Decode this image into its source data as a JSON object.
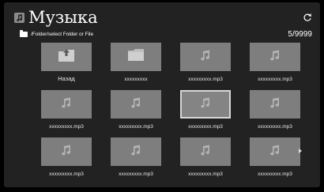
{
  "header": {
    "title": "Музыка",
    "path": "/Folder/select Folder or File",
    "counter": "5/9999"
  },
  "items": [
    {
      "label": "Назад",
      "type": "back",
      "icon": "folder-up-icon"
    },
    {
      "label": "xxxxxxxxx",
      "type": "folder",
      "icon": "folder-icon"
    },
    {
      "label": "xxxxxxxxx.mp3",
      "type": "file",
      "icon": "music-note-icon"
    },
    {
      "label": "xxxxxxxxx.mp3",
      "type": "file",
      "icon": "music-note-icon"
    },
    {
      "label": "xxxxxxxxx.mp3",
      "type": "file",
      "icon": "music-note-icon"
    },
    {
      "label": "xxxxxxxxx.mp3",
      "type": "file",
      "icon": "music-note-icon"
    },
    {
      "label": "xxxxxxxxx.mp3",
      "type": "file",
      "icon": "music-note-icon",
      "selected": true
    },
    {
      "label": "xxxxxxxxx.mp3",
      "type": "file",
      "icon": "music-note-icon"
    },
    {
      "label": "xxxxxxxxx.mp3",
      "type": "file",
      "icon": "music-note-icon"
    },
    {
      "label": "xxxxxxxxx.mp3",
      "type": "file",
      "icon": "music-note-icon"
    },
    {
      "label": "xxxxxxxxx.mp3",
      "type": "file",
      "icon": "music-note-icon"
    },
    {
      "label": "xxxxxxxxx.mp3",
      "type": "file",
      "icon": "music-note-icon"
    }
  ],
  "colors": {
    "background": "#222222",
    "tile": "#7e7e7e",
    "selection_border": "#d8d8d8"
  }
}
